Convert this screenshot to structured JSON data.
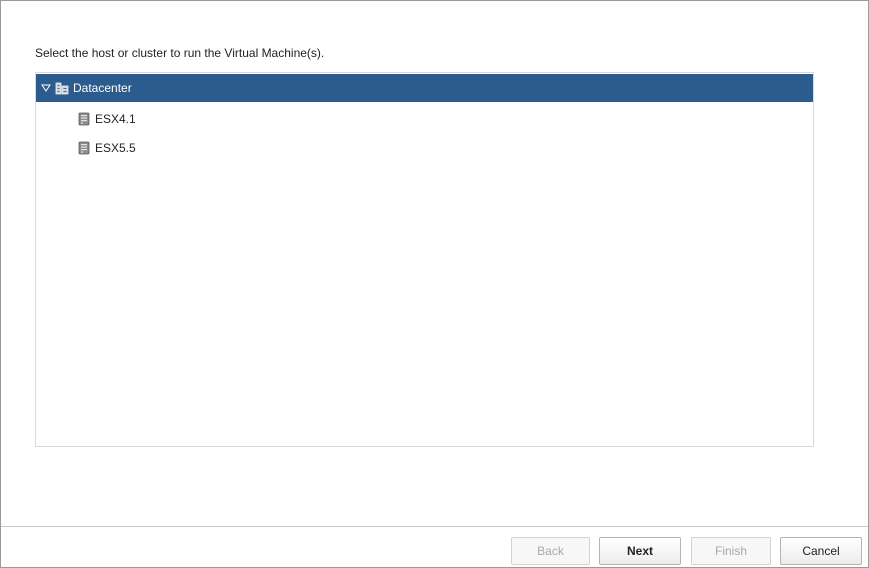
{
  "instruction": "Select the host or cluster to run the Virtual Machine(s).",
  "tree": {
    "root": {
      "label": "Datacenter",
      "icon": "datacenter-icon",
      "expanded": true,
      "selected": true
    },
    "children": [
      {
        "label": "ESX4.1",
        "icon": "host-server-icon"
      },
      {
        "label": "ESX5.5",
        "icon": "host-server-icon"
      }
    ]
  },
  "buttons": {
    "back": {
      "label": "Back",
      "enabled": false
    },
    "next": {
      "label": "Next",
      "enabled": true
    },
    "finish": {
      "label": "Finish",
      "enabled": false
    },
    "cancel": {
      "label": "Cancel",
      "enabled": true
    }
  },
  "colors": {
    "selection": "#2c5b8e",
    "border": "#d9d9d9"
  }
}
